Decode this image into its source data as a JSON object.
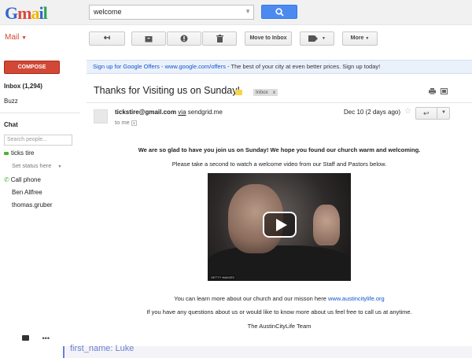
{
  "logo": "Gmail",
  "search": {
    "value": "welcome"
  },
  "mail_menu": "Mail",
  "toolbar": {
    "move_to_inbox": "Move to Inbox",
    "more": "More"
  },
  "sidebar": {
    "compose": "COMPOSE",
    "inbox": "Inbox (1,294)",
    "buzz": "Buzz",
    "chat_header": "Chat",
    "search_people_placeholder": "Search people...",
    "contacts": [
      {
        "name": "ticks tire",
        "status": "online"
      },
      {
        "name": "Set status here"
      },
      {
        "name": "Call phone"
      },
      {
        "name": "Ben Allfree"
      },
      {
        "name": "thomas.gruber"
      }
    ]
  },
  "offer": {
    "link": "Sign up for Google Offers - www.google.com/offers",
    "text": " - The best of your city at even better prices. Sign up today!"
  },
  "message": {
    "subject": "Thanks for Visiting us on Sunday!",
    "label": "Inbox",
    "label_remove": "x",
    "sender_email": "tickstire@gmail.com",
    "via_word": "via",
    "via_domain": "sendgrid.me",
    "to": "to me",
    "date": "Dec 10 (2 days ago)",
    "body": {
      "line1": "We are so glad to have you join us on Sunday!  We hope you found our church warm and welcoming.",
      "line2": "Please take a second to watch a welcome video from our Staff and Pastors below.",
      "video_credit": "GETTY IMAGES",
      "line3": "You can learn more about our church and our misson here ",
      "line3_link": "www.austincitylife.org",
      "line4": "If you have any questions about us or would like to know more about us feel free to call us at anytime.",
      "signature": "The AustinCityLife Team"
    }
  },
  "bottom_peek": "first_name: Luke"
}
